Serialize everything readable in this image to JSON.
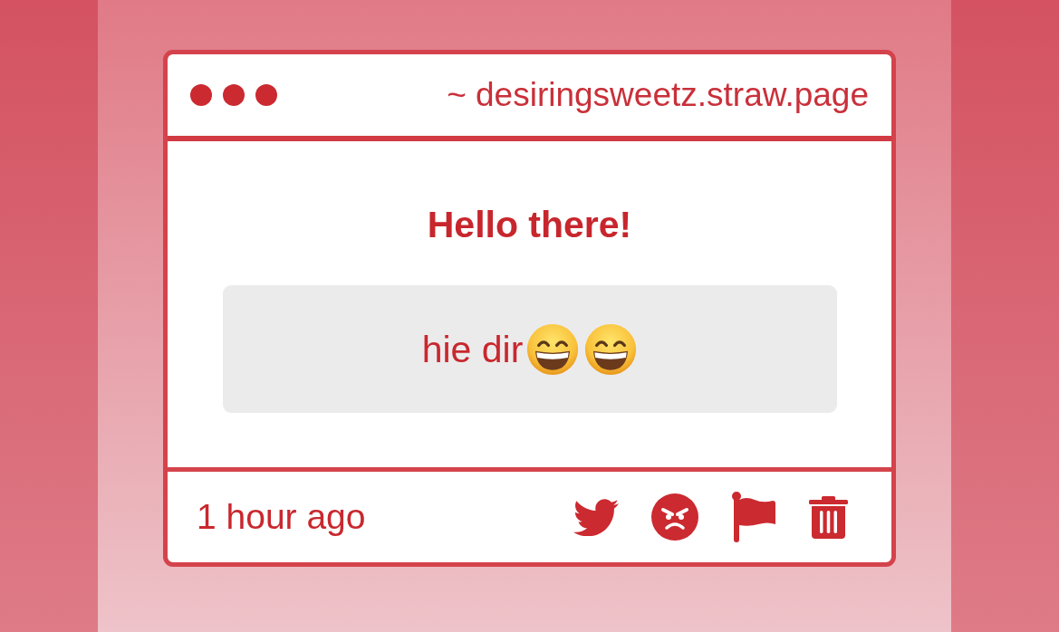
{
  "window": {
    "address": "~ desiringsweetz.straw.page"
  },
  "message": {
    "title": "Hello there!",
    "text": "hie dir",
    "emojis": [
      {
        "kind": "grinning"
      },
      {
        "kind": "grinning"
      }
    ]
  },
  "footer": {
    "time": "1 hour ago",
    "actions": [
      {
        "kind": "tweet"
      },
      {
        "kind": "angry"
      },
      {
        "kind": "flag"
      },
      {
        "kind": "delete"
      }
    ]
  }
}
